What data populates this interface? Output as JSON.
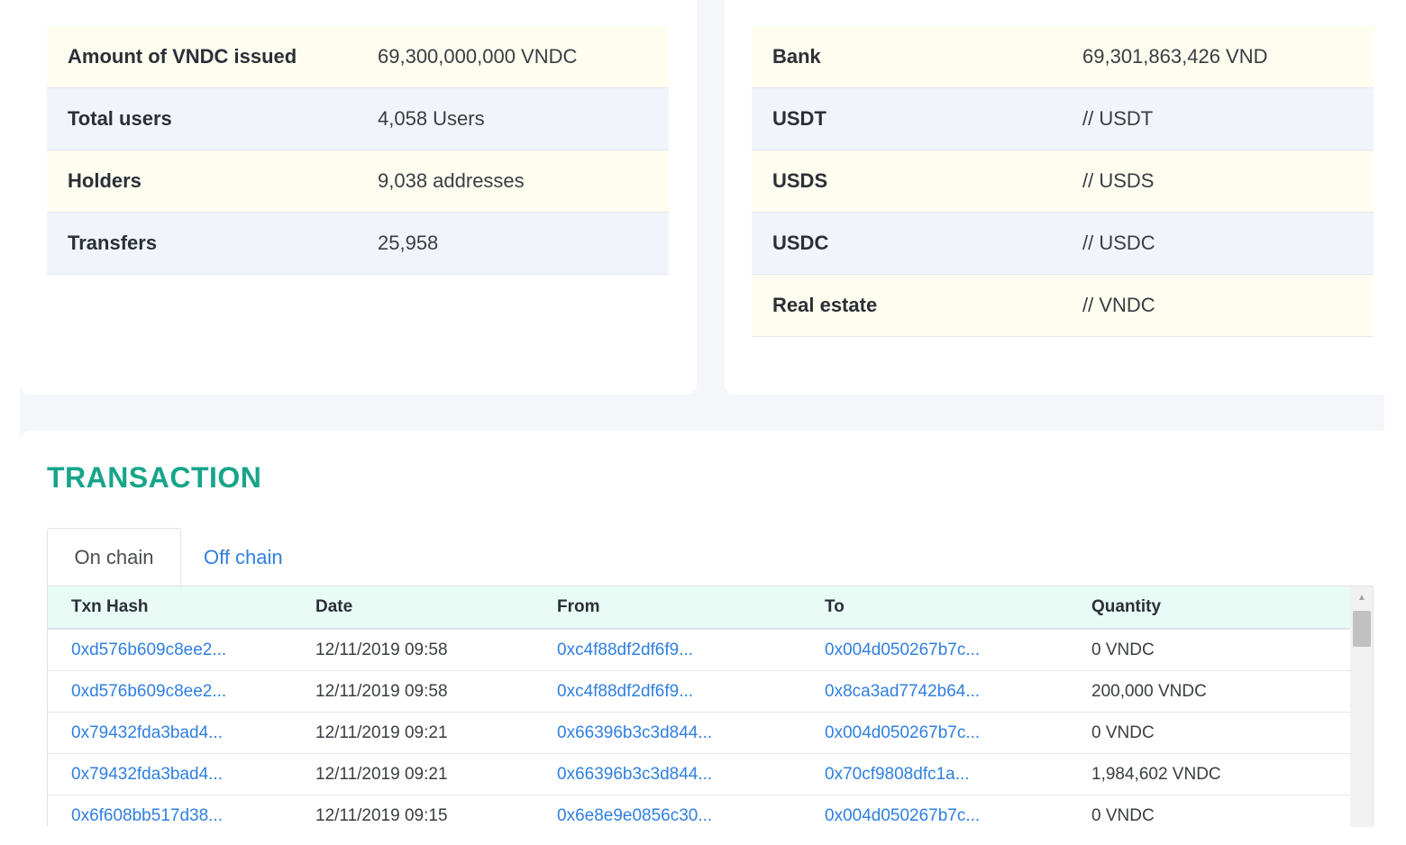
{
  "summary_left": {
    "rows": [
      {
        "label": "Amount of VNDC issued",
        "value": "69,300,000,000 VNDC"
      },
      {
        "label": "Total users",
        "value": "4,058 Users"
      },
      {
        "label": "Holders",
        "value": "9,038 addresses"
      },
      {
        "label": "Transfers",
        "value": "25,958"
      }
    ]
  },
  "summary_right": {
    "rows": [
      {
        "label": "Bank",
        "value": "69,301,863,426 VND"
      },
      {
        "label": "USDT",
        "value": "// USDT"
      },
      {
        "label": "USDS",
        "value": "// USDS"
      },
      {
        "label": "USDC",
        "value": "// USDC"
      },
      {
        "label": "Real estate",
        "value": "// VNDC"
      }
    ]
  },
  "transaction": {
    "title": "TRANSACTION",
    "tabs": [
      {
        "label": "On chain",
        "active": true
      },
      {
        "label": "Off chain",
        "active": false
      }
    ],
    "columns": [
      "Txn Hash",
      "Date",
      "From",
      "To",
      "Quantity"
    ],
    "rows": [
      {
        "hash": "0xd576b609c8ee2...",
        "date": "12/11/2019 09:58",
        "from": "0xc4f88df2df6f9...",
        "to": "0x004d050267b7c...",
        "quantity": "0 VNDC"
      },
      {
        "hash": "0xd576b609c8ee2...",
        "date": "12/11/2019 09:58",
        "from": "0xc4f88df2df6f9...",
        "to": "0x8ca3ad7742b64...",
        "quantity": "200,000 VNDC"
      },
      {
        "hash": "0x79432fda3bad4...",
        "date": "12/11/2019 09:21",
        "from": "0x66396b3c3d844...",
        "to": "0x004d050267b7c...",
        "quantity": "0 VNDC"
      },
      {
        "hash": "0x79432fda3bad4...",
        "date": "12/11/2019 09:21",
        "from": "0x66396b3c3d844...",
        "to": "0x70cf9808dfc1a...",
        "quantity": "1,984,602 VNDC"
      },
      {
        "hash": "0x6f608bb517d38...",
        "date": "12/11/2019 09:15",
        "from": "0x6e8e9e0856c30...",
        "to": "0x004d050267b7c...",
        "quantity": "0 VNDC"
      }
    ]
  },
  "colors": {
    "accent_green": "#17a58a",
    "link_blue": "#2f7fe0",
    "row_yellow": "#fefdf0",
    "row_blue": "#f1f5fb",
    "header_mint": "#e8fbf5"
  },
  "icons": {
    "scroll_up": "scroll-up-arrow-icon"
  }
}
